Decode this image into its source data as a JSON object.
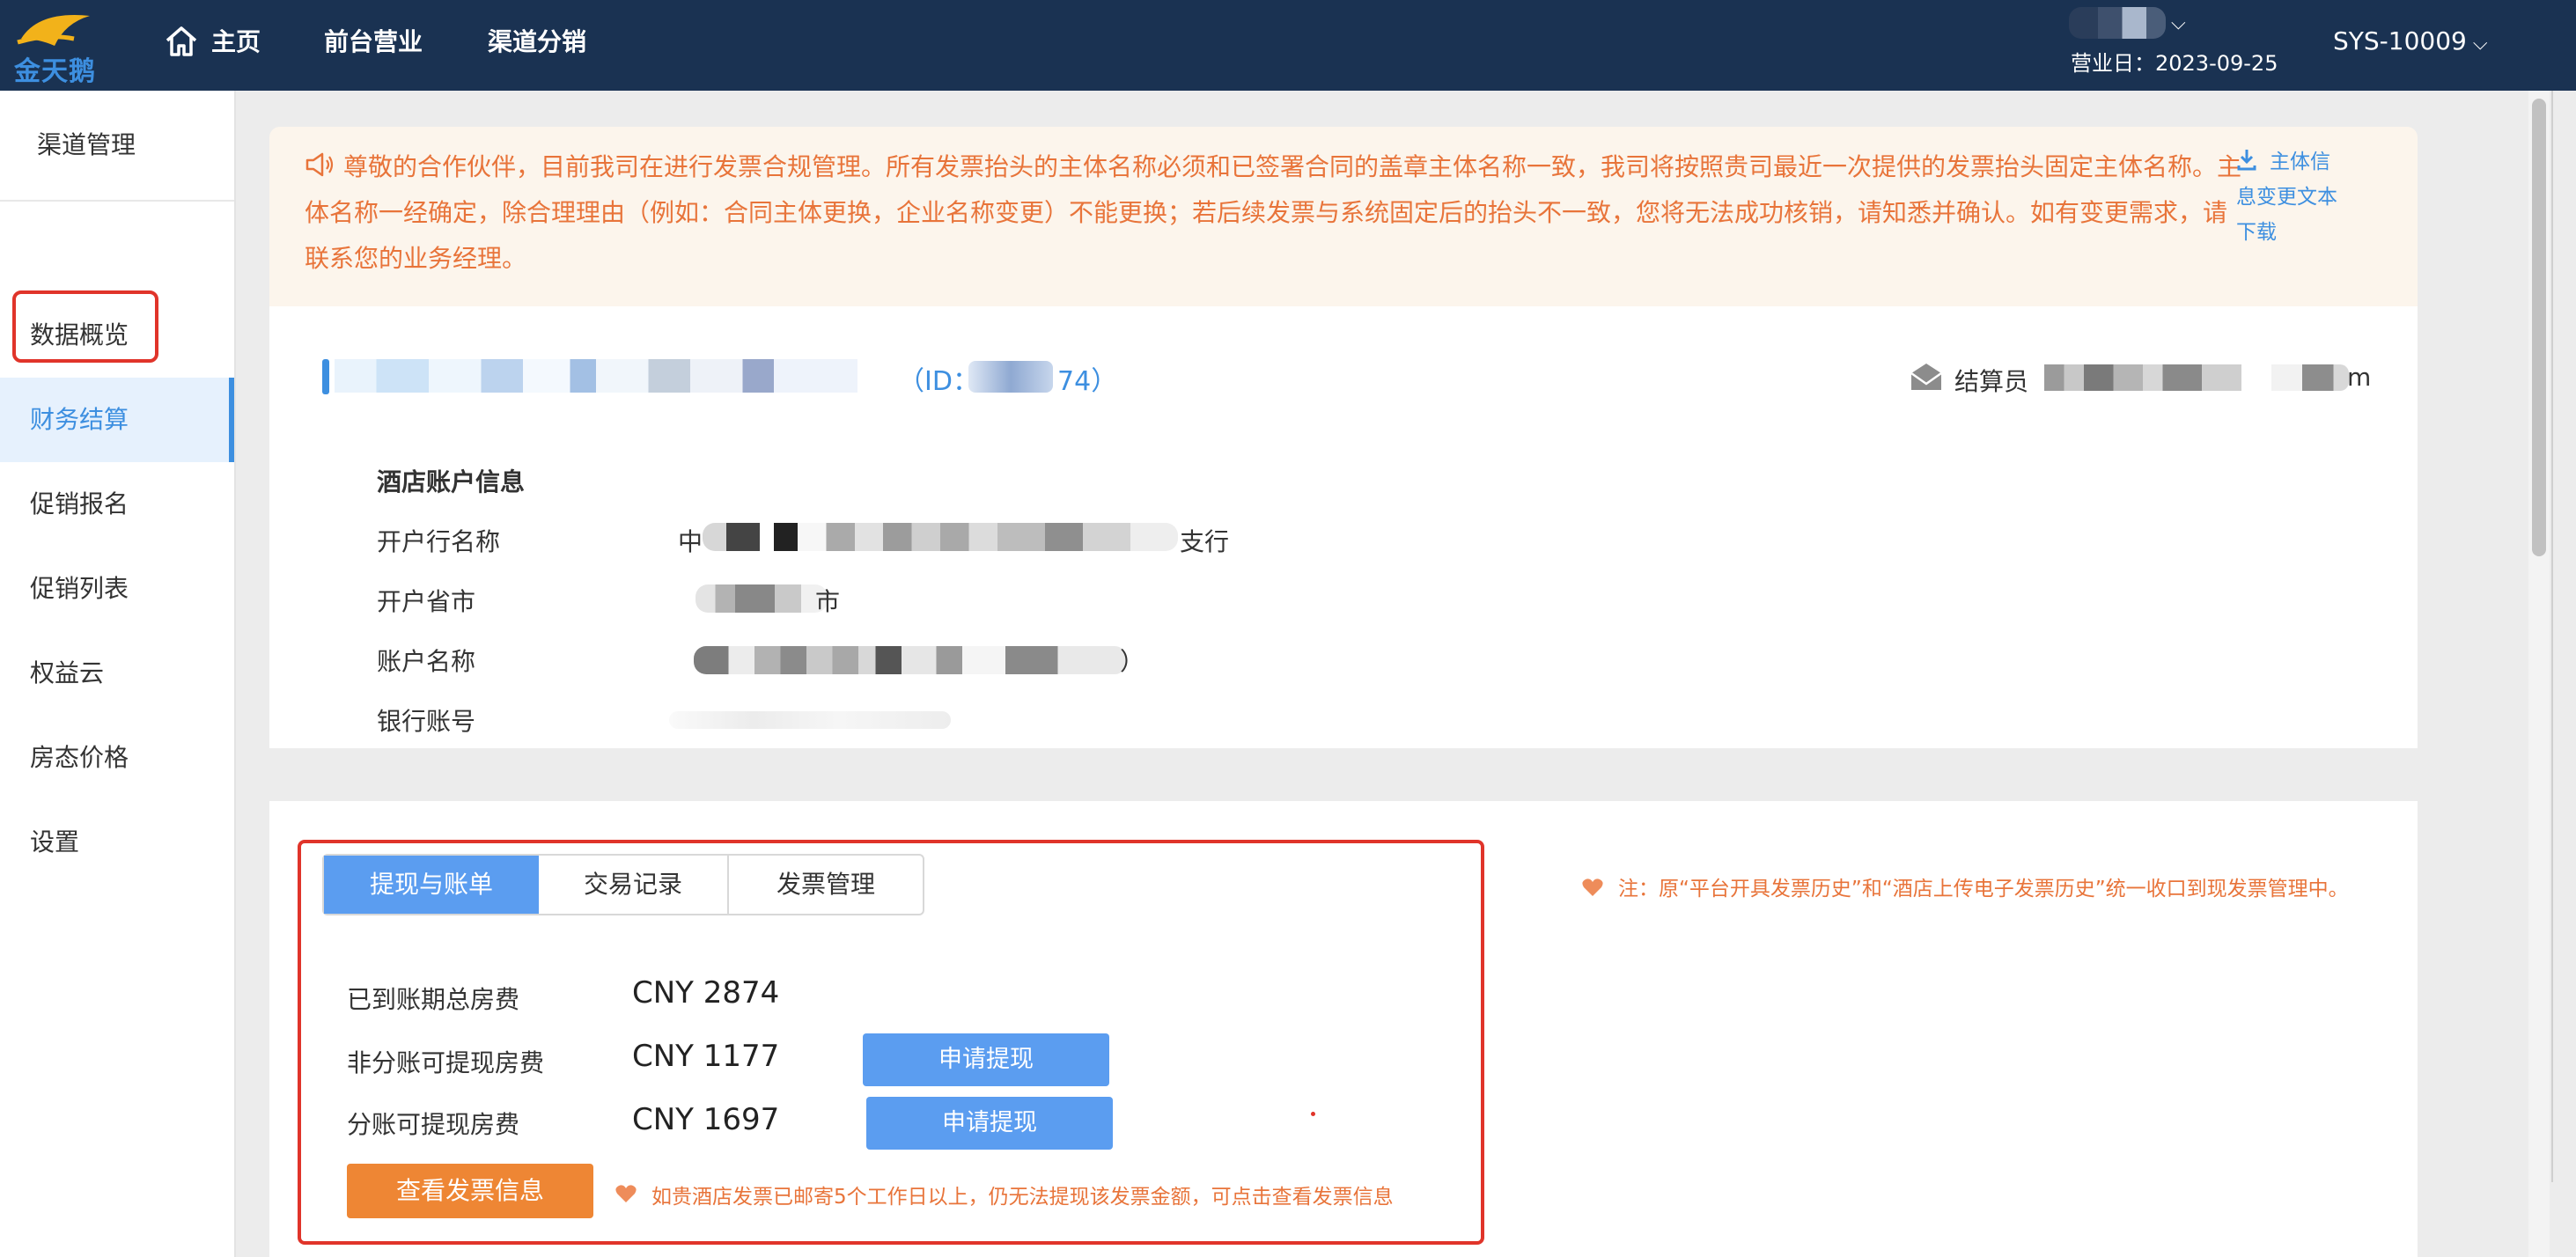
{
  "header": {
    "logo_text": "金天鹅",
    "nav": [
      {
        "label": "主页",
        "icon": "home-icon"
      },
      {
        "label": "前台营业"
      },
      {
        "label": "渠道分销"
      }
    ],
    "business_day": "营业日：2023-09-25",
    "system_id": "SYS-10009"
  },
  "sidebar": {
    "title": "渠道管理",
    "items": [
      {
        "label": "数据概览"
      },
      {
        "label": "财务结算",
        "active": true
      },
      {
        "label": "促销报名"
      },
      {
        "label": "促销列表"
      },
      {
        "label": "权益云"
      },
      {
        "label": "房态价格"
      },
      {
        "label": "设置"
      }
    ]
  },
  "notice": {
    "icon": "speaker-icon",
    "text": "尊敬的合作伙伴，目前我司在进行发票合规管理。所有发票抬头的主体名称必须和已签署合同的盖章主体名称一致，我司将按照贵司最近一次提供的发票抬头固定主体名称。主体名称一经确定，除合理理由（例如：合同主体更换，企业名称变更）不能更换；若后续发票与系统固定后的抬头不一致，您将无法成功核销，请知悉并确认。如有变更需求，请联系您的业务经理。",
    "download_link": "主体信息变更文本下载"
  },
  "hotel": {
    "id_prefix": "（ID：5",
    "id_suffix": "74）",
    "settlement_label": "结算员",
    "settlement_tail": "m"
  },
  "account": {
    "title": "酒店账户信息",
    "fields": [
      {
        "label": "开户行名称",
        "prefix": "中",
        "suffix": "支行"
      },
      {
        "label": "开户省市",
        "suffix": "市"
      },
      {
        "label": "账户名称",
        "suffix": "）"
      },
      {
        "label": "银行账号"
      }
    ]
  },
  "tabs": [
    {
      "label": "提现与账单",
      "active": true
    },
    {
      "label": "交易记录"
    },
    {
      "label": "发票管理"
    }
  ],
  "tab_note": "注：原“平台开具发票历史”和“酒店上传电子发票历史”统一收口到现发票管理中。",
  "withdraw": {
    "rows": [
      {
        "label": "已到账期总房费",
        "value": "CNY 2874"
      },
      {
        "label": "非分账可提现房费",
        "value": "CNY 1177",
        "button": "申请提现"
      },
      {
        "label": "分账可提现房费",
        "value": "CNY 1697",
        "button": "申请提现"
      }
    ],
    "invoice_button": "查看发票信息",
    "invoice_hint": "如贵酒店发票已邮寄5个工作日以上，仍无法提现该发票金额，可点击查看发票信息"
  },
  "colors": {
    "header_bg": "#1a3252",
    "accent_blue": "#5b9df0",
    "notice_orange": "#e8743a",
    "highlight_red": "#e0342a",
    "button_orange": "#ee8634"
  }
}
